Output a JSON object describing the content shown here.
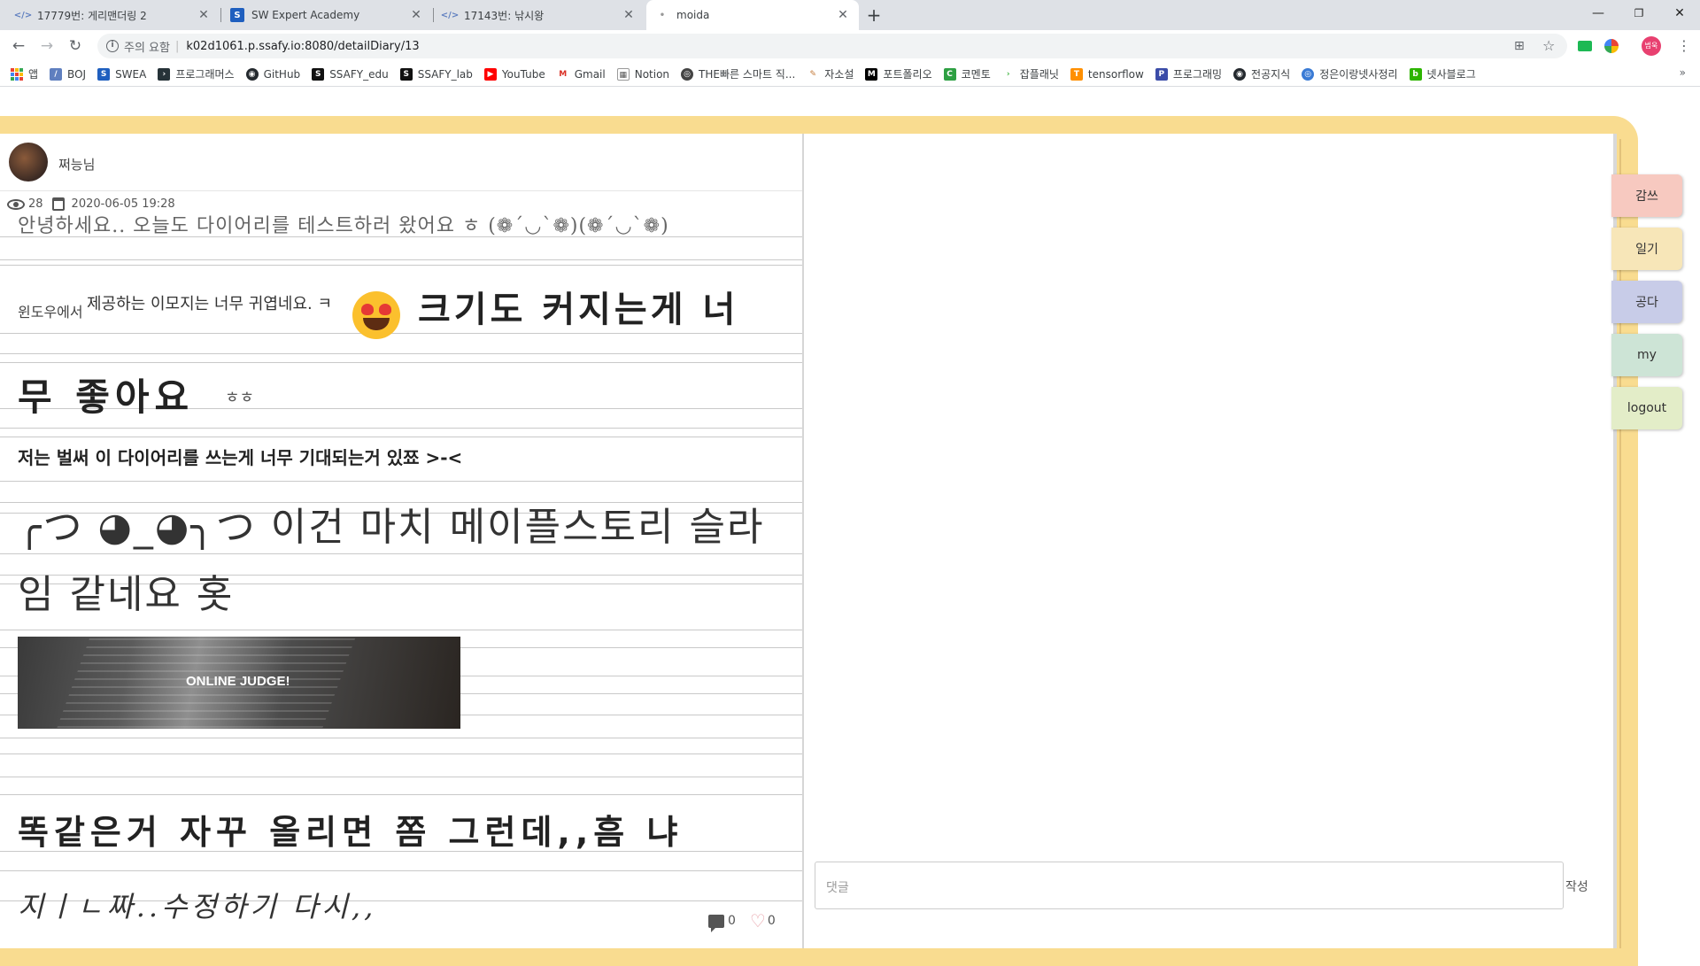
{
  "browser": {
    "tabs": [
      {
        "label": "17779번: 게리맨더링 2",
        "icon": "boj-icon"
      },
      {
        "label": "SW Expert Academy",
        "icon": "swea-icon"
      },
      {
        "label": "17143번: 낚시왕",
        "icon": "boj-icon"
      },
      {
        "label": "moida",
        "icon": "page-icon"
      }
    ],
    "new_tab": "+",
    "window": {
      "minimize": "—",
      "restore": "❐",
      "close": "✕"
    },
    "url": {
      "warning": "주의 요함",
      "address": "k02d1061.p.ssafy.io:8080/detailDiary/13"
    },
    "profile_label": "범욱",
    "bookmarks": [
      {
        "label": "앱",
        "color": "#4285f4"
      },
      {
        "label": "BOJ",
        "color": "#5f7fbf"
      },
      {
        "label": "SWEA",
        "color": "#1f5fbf"
      },
      {
        "label": "프로그래머스",
        "color": "#263238"
      },
      {
        "label": "GitHub",
        "color": "#24292e"
      },
      {
        "label": "SSAFY_edu",
        "color": "#111111"
      },
      {
        "label": "SSAFY_lab",
        "color": "#111111"
      },
      {
        "label": "YouTube",
        "color": "#ff0000"
      },
      {
        "label": "Gmail",
        "color": "#d93025"
      },
      {
        "label": "Notion",
        "color": "#555555"
      },
      {
        "label": "THE빠른 스마트 직...",
        "color": "#444444"
      },
      {
        "label": "자소설",
        "color": "#c47a3a"
      },
      {
        "label": "포트폴리오",
        "color": "#000000"
      },
      {
        "label": "코멘토",
        "color": "#2ea043"
      },
      {
        "label": "잡플래닛",
        "color": "#41b541"
      },
      {
        "label": "tensorflow",
        "color": "#ff8f00"
      },
      {
        "label": "프로그래밍",
        "color": "#3b4ca8"
      },
      {
        "label": "전공지식",
        "color": "#24292e"
      },
      {
        "label": "정은이랑넷사정리",
        "color": "#3a7bd5"
      },
      {
        "label": "넷사블로그",
        "color": "#2db400"
      }
    ],
    "bookmarks_more": "»"
  },
  "diary": {
    "author": "쩌능님",
    "views": "28",
    "date": "2020-06-05 19:28",
    "lines": {
      "l1": "안녕하세요.. 오늘도 다이어리를 테스트하러 왔어요 ㅎ (❁´◡`❁)(❁´◡`❁)",
      "l2_small": "윈도우에서",
      "l2_mid": "제공하는 이모지는 너무 귀엽네요. ㅋ",
      "l2_big": "크기도 커지는게 너",
      "l3_big": "무 좋아요",
      "l3_small": "ㅎㅎ",
      "l4": "저는 벌써 이 다이어리를 쓰는게 너무 기대되는거 있쬬 >-<",
      "l5": "╭つ ◕_◕╮つ 이건 마치 메이플스토리 슬라",
      "l6": "임 같네요 홋",
      "l7": "똑같은거 자꾸 올리면 쫌 그런데,,흠 냐",
      "l8": "지ㅣㄴ짜..수정하기 다시,,"
    },
    "banner_text": "ONLINE JUDGE!",
    "comment_count": "0",
    "like_count": "0"
  },
  "comments": {
    "placeholder": "댓글",
    "submit_label": "작성"
  },
  "side_tabs": [
    {
      "label": "감쓰",
      "color": "#f7c9c0"
    },
    {
      "label": "일기",
      "color": "#f7e6b8"
    },
    {
      "label": "공다",
      "color": "#c8cce8"
    },
    {
      "label": "my",
      "color": "#cde4d6"
    },
    {
      "label": "logout",
      "color": "#e3edc8"
    }
  ]
}
